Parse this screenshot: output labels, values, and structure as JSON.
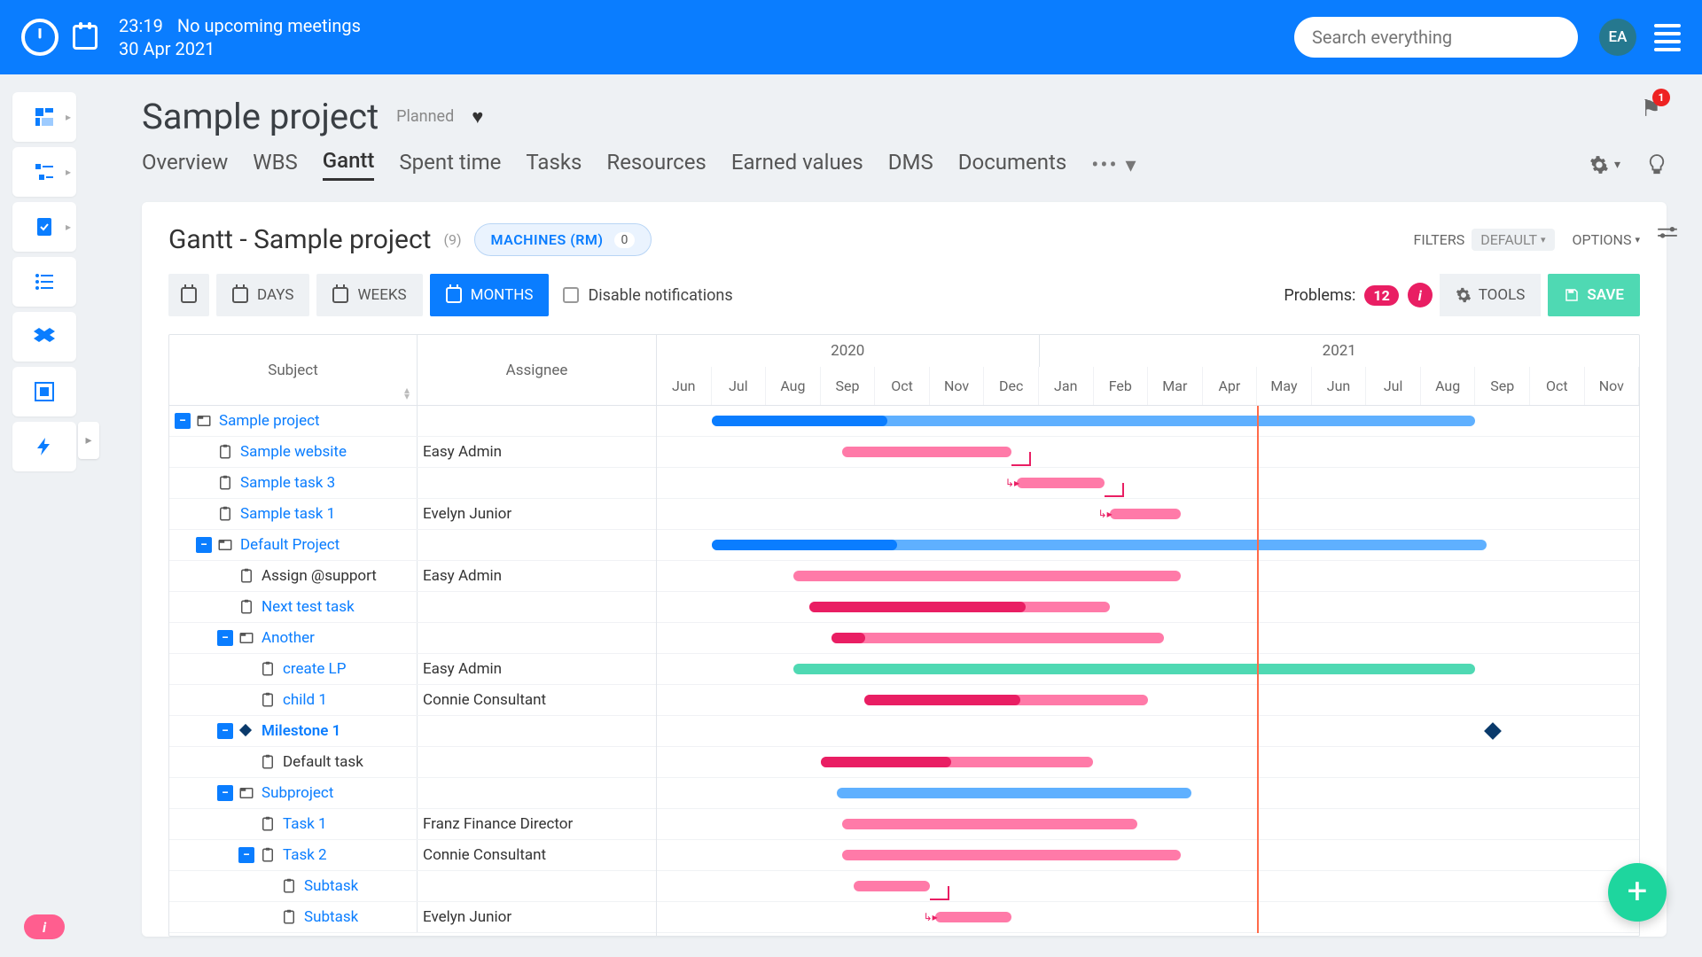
{
  "header": {
    "time": "23:19",
    "meeting_status": "No upcoming meetings",
    "date": "30 Apr 2021",
    "search_placeholder": "Search everything",
    "avatar_initials": "EA"
  },
  "project": {
    "title": "Sample project",
    "status": "Planned",
    "flag_count": "1"
  },
  "tabs": [
    "Overview",
    "WBS",
    "Gantt",
    "Spent time",
    "Tasks",
    "Resources",
    "Earned values",
    "DMS",
    "Documents"
  ],
  "active_tab": 2,
  "panel": {
    "title": "Gantt - Sample project",
    "count": "(9)",
    "machines_label": "MACHINES (RM)",
    "machines_count": "0",
    "filters_label": "FILTERS",
    "filters_value": "DEFAULT",
    "options_label": "OPTIONS"
  },
  "toolbar": {
    "days": "DAYS",
    "weeks": "WEEKS",
    "months": "MONTHS",
    "disable_notifications": "Disable notifications",
    "problems_label": "Problems:",
    "problems_count": "12",
    "tools": "TOOLS",
    "save": "SAVE"
  },
  "grid": {
    "subject_header": "Subject",
    "assignee_header": "Assignee",
    "years": [
      "2020",
      "2021"
    ],
    "months": [
      "Jun",
      "Jul",
      "Aug",
      "Sep",
      "Oct",
      "Nov",
      "Dec",
      "Jan",
      "Feb",
      "Mar",
      "Apr",
      "May",
      "Jun",
      "Jul",
      "Aug",
      "Sep",
      "Oct",
      "Nov"
    ],
    "today_col": 11,
    "rows": [
      {
        "indent": 0,
        "toggle": true,
        "icon": "project",
        "label": "Sample project",
        "link": true,
        "assignee": "",
        "bar": {
          "type": "blue",
          "start": 1,
          "end": 15,
          "progress": 0.23
        }
      },
      {
        "indent": 1,
        "icon": "task",
        "label": "Sample website",
        "link": true,
        "assignee": "Easy Admin",
        "bar": {
          "type": "pink",
          "start": 3.4,
          "end": 6.5,
          "progress": 0
        },
        "bracket_end": true
      },
      {
        "indent": 1,
        "icon": "task",
        "label": "Sample task 3",
        "link": true,
        "assignee": "",
        "bar": {
          "type": "pink",
          "start": 6.6,
          "end": 8.2,
          "progress": 0
        },
        "bracket_end": true,
        "arrow_in": true
      },
      {
        "indent": 1,
        "icon": "task",
        "label": "Sample task 1",
        "link": true,
        "assignee": "Evelyn Junior",
        "bar": {
          "type": "pink",
          "start": 8.3,
          "end": 9.6,
          "progress": 0
        },
        "arrow_in": true
      },
      {
        "indent": 1,
        "toggle": true,
        "icon": "project",
        "label": "Default Project",
        "link": true,
        "assignee": "",
        "bar": {
          "type": "blue",
          "start": 1,
          "end": 15.2,
          "progress": 0.24
        }
      },
      {
        "indent": 2,
        "icon": "task",
        "label": "Assign @support",
        "link": false,
        "assignee": "Easy Admin",
        "bar": {
          "type": "pink",
          "start": 2.5,
          "end": 9.6,
          "progress": 0
        }
      },
      {
        "indent": 2,
        "icon": "task",
        "label": "Next test task",
        "link": true,
        "assignee": "",
        "bar": {
          "type": "pink",
          "start": 2.8,
          "end": 8.3,
          "progress": 0.72
        }
      },
      {
        "indent": 2,
        "toggle": true,
        "icon": "project",
        "label": "Another",
        "link": true,
        "assignee": "",
        "bar": {
          "type": "pink",
          "start": 3.2,
          "end": 9.3,
          "progress": 0.1
        }
      },
      {
        "indent": 3,
        "icon": "task",
        "label": "create LP",
        "link": true,
        "assignee": "Easy Admin",
        "bar": {
          "type": "green",
          "start": 2.5,
          "end": 15,
          "progress": 0
        }
      },
      {
        "indent": 3,
        "icon": "task",
        "label": "child 1",
        "link": true,
        "assignee": "Connie Consultant",
        "bar": {
          "type": "pink",
          "start": 3.8,
          "end": 9.0,
          "progress": 0.55
        }
      },
      {
        "indent": 2,
        "toggle": true,
        "icon": "milestone",
        "label": "Milestone 1",
        "link": true,
        "bold": true,
        "assignee": "",
        "milestone": {
          "col": 15.2
        }
      },
      {
        "indent": 3,
        "icon": "task",
        "label": "Default task",
        "link": false,
        "assignee": "",
        "bar": {
          "type": "pink",
          "start": 3,
          "end": 8,
          "progress": 0.48
        }
      },
      {
        "indent": 2,
        "toggle": true,
        "icon": "project",
        "label": "Subproject",
        "link": true,
        "assignee": "",
        "bar": {
          "type": "blue",
          "start": 3.3,
          "end": 9.8,
          "progress": 0
        }
      },
      {
        "indent": 3,
        "icon": "task",
        "label": "Task 1",
        "link": true,
        "assignee": "Franz Finance Director",
        "bar": {
          "type": "pink",
          "start": 3.4,
          "end": 8.8,
          "progress": 0
        }
      },
      {
        "indent": 3,
        "toggle": true,
        "icon": "task",
        "label": "Task 2",
        "link": true,
        "assignee": "Connie Consultant",
        "bar": {
          "type": "pink",
          "start": 3.4,
          "end": 9.6,
          "progress": 0
        }
      },
      {
        "indent": 4,
        "icon": "task",
        "label": "Subtask",
        "link": true,
        "assignee": "",
        "bar": {
          "type": "pink",
          "start": 3.6,
          "end": 5,
          "progress": 0
        },
        "bracket_end": true
      },
      {
        "indent": 4,
        "icon": "task",
        "label": "Subtask",
        "link": true,
        "assignee": "Evelyn Junior",
        "bar": {
          "type": "pink",
          "start": 5.1,
          "end": 6.5,
          "progress": 0
        },
        "arrow_in": true
      }
    ]
  }
}
